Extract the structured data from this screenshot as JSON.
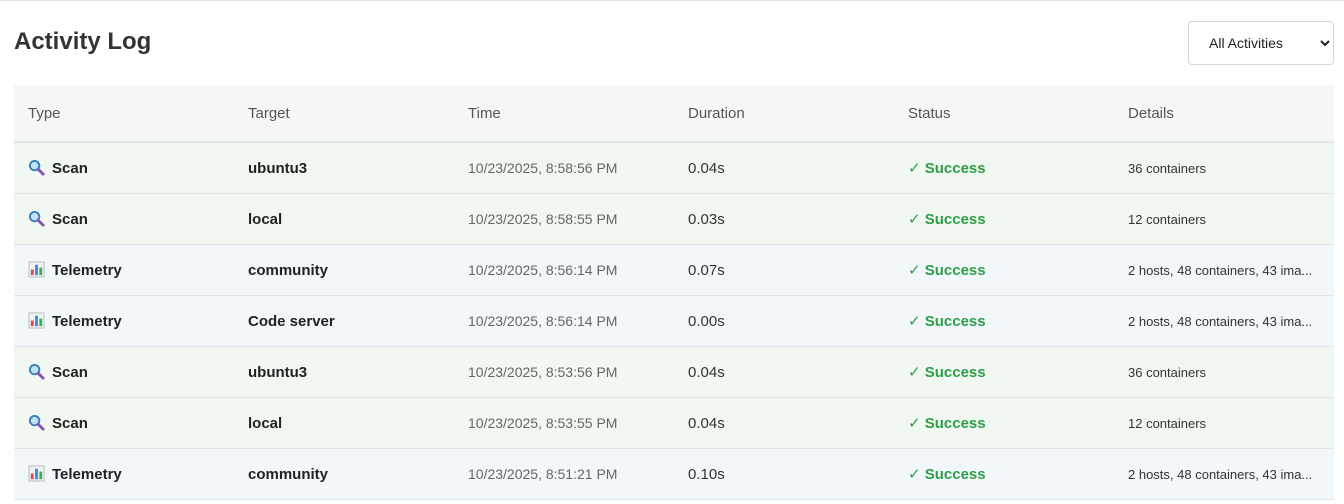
{
  "header": {
    "title": "Activity Log",
    "filter": {
      "selected": "All Activities",
      "options": [
        "All Activities"
      ]
    }
  },
  "table": {
    "columns": [
      "Type",
      "Target",
      "Time",
      "Duration",
      "Status",
      "Details"
    ],
    "rows": [
      {
        "kind": "scan",
        "icon": "magnifier-icon",
        "type": "Scan",
        "target": "ubuntu3",
        "time": "10/23/2025, 8:58:56 PM",
        "duration": "0.04s",
        "status": "✓ Success",
        "details": "36 containers"
      },
      {
        "kind": "scan",
        "icon": "magnifier-icon",
        "type": "Scan",
        "target": "local",
        "time": "10/23/2025, 8:58:55 PM",
        "duration": "0.03s",
        "status": "✓ Success",
        "details": "12 containers"
      },
      {
        "kind": "telemetry",
        "icon": "bar-chart-icon",
        "type": "Telemetry",
        "target": "community",
        "time": "10/23/2025, 8:56:14 PM",
        "duration": "0.07s",
        "status": "✓ Success",
        "details": "2 hosts, 48 containers, 43 ima..."
      },
      {
        "kind": "telemetry",
        "icon": "bar-chart-icon",
        "type": "Telemetry",
        "target": "Code server",
        "time": "10/23/2025, 8:56:14 PM",
        "duration": "0.00s",
        "status": "✓ Success",
        "details": "2 hosts, 48 containers, 43 ima..."
      },
      {
        "kind": "scan",
        "icon": "magnifier-icon",
        "type": "Scan",
        "target": "ubuntu3",
        "time": "10/23/2025, 8:53:56 PM",
        "duration": "0.04s",
        "status": "✓ Success",
        "details": "36 containers"
      },
      {
        "kind": "scan",
        "icon": "magnifier-icon",
        "type": "Scan",
        "target": "local",
        "time": "10/23/2025, 8:53:55 PM",
        "duration": "0.04s",
        "status": "✓ Success",
        "details": "12 containers"
      },
      {
        "kind": "telemetry",
        "icon": "bar-chart-icon",
        "type": "Telemetry",
        "target": "community",
        "time": "10/23/2025, 8:51:21 PM",
        "duration": "0.10s",
        "status": "✓ Success",
        "details": "2 hosts, 48 containers, 43 ima..."
      }
    ]
  },
  "colors": {
    "success": "#2e9e48",
    "scan_row_bg": "#f1f8f1",
    "telemetry_row_bg": "#f2f7fb",
    "header_bg": "#f5f6f8"
  }
}
